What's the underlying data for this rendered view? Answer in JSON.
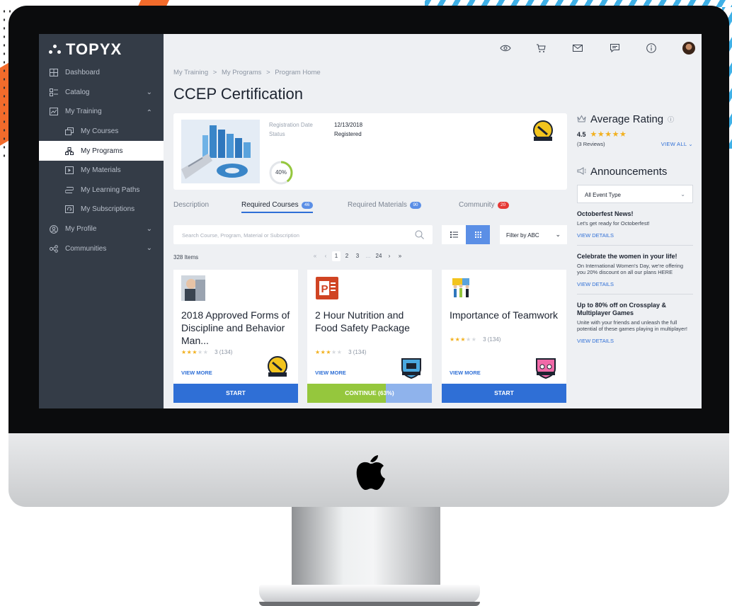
{
  "app": {
    "logo_text": "TOPYX"
  },
  "sidebar": {
    "items": [
      {
        "label": "Dashboard",
        "icon": "dashboard-icon",
        "level": 0,
        "expandable": false
      },
      {
        "label": "Catalog",
        "icon": "catalog-icon",
        "level": 0,
        "expandable": true,
        "expanded": false
      },
      {
        "label": "My Training",
        "icon": "chart-icon",
        "level": 0,
        "expandable": true,
        "expanded": true
      },
      {
        "label": "My Courses",
        "icon": "courses-icon",
        "level": 1
      },
      {
        "label": "My Programs",
        "icon": "programs-icon",
        "level": 1,
        "active": true
      },
      {
        "label": "My Materials",
        "icon": "materials-icon",
        "level": 1
      },
      {
        "label": "My Learning Paths",
        "icon": "learning-paths-icon",
        "level": 1
      },
      {
        "label": "My Subscriptions",
        "icon": "subscriptions-icon",
        "level": 1
      },
      {
        "label": "My Profile",
        "icon": "profile-icon",
        "level": 0,
        "expandable": true,
        "expanded": false
      },
      {
        "label": "Communities",
        "icon": "communities-icon",
        "level": 0,
        "expandable": true,
        "expanded": false
      }
    ]
  },
  "topbar": {
    "icons": [
      "eye-icon",
      "cart-icon",
      "mail-icon",
      "chat-icon",
      "info-icon",
      "avatar"
    ]
  },
  "breadcrumb": {
    "items": [
      "My Training",
      "My Programs",
      "Program Home"
    ],
    "separator": ">"
  },
  "page_title": "CCEP Certification",
  "program": {
    "registration_label": "Registration Date",
    "registration_value": "12/13/2018",
    "status_label": "Status",
    "status_value": "Registered",
    "progress": 40,
    "progress_text": "40%"
  },
  "tabs": [
    {
      "label": "Description",
      "count": null
    },
    {
      "label": "Required Courses",
      "count": "46",
      "count_color": "#5b8fe6",
      "active": true
    },
    {
      "label": "Required Materials",
      "count": "90",
      "count_color": "#5b8fe6"
    },
    {
      "label": "Community",
      "count": "20",
      "count_color": "#e53935"
    }
  ],
  "search": {
    "placeholder": "Search Course, Program, Material or Subscription"
  },
  "filter": {
    "label": "Filter by ABC"
  },
  "items_count": "328 Items",
  "pagination": [
    "«",
    "‹",
    "1",
    "2",
    "3",
    "...",
    "24",
    "›",
    "»"
  ],
  "courses": [
    {
      "title": "2018 Approved Forms of Discipline and Behavior Man...",
      "rating": 3,
      "rating_count": "3 (134)",
      "view_more": "VIEW MORE",
      "button": "START",
      "progress": null
    },
    {
      "title": "2 Hour Nutrition and Food Safety Package",
      "rating": 3,
      "rating_count": "3 (134)",
      "view_more": "VIEW MORE",
      "button": "CONTINUE (63%)",
      "progress": 63
    },
    {
      "title": "Importance of Teamwork",
      "rating": 3,
      "rating_count": "3 (134)",
      "view_more": "VIEW MORE",
      "button": "START",
      "progress": null
    }
  ],
  "rating_panel": {
    "title": "Average Rating",
    "value": "4.5",
    "reviews": "(3 Reviews)",
    "view_all": "VIEW ALL"
  },
  "announcements": {
    "title": "Announcements",
    "filter": "All Event Type",
    "items": [
      {
        "title": "Octoberfest News!",
        "body": "Let's get ready for Octoberfest!",
        "link": "VIEW DETAILS"
      },
      {
        "title": "Celebrate the women in your life!",
        "body": "On International Women's Day, we're offering you 20% discount on all our plans HERE",
        "link": "VIEW DETAILS"
      },
      {
        "title": "Up to 80% off on Crossplay & Multiplayer Games",
        "body": "Unite with your friends and unleash the full potential of these games playing in multiplayer!",
        "link": "VIEW DETAILS"
      }
    ]
  },
  "colors": {
    "accent": "#2f6fd6",
    "sidebar": "#343c47",
    "progress_green": "#95c73d",
    "star": "#f2b01e"
  }
}
